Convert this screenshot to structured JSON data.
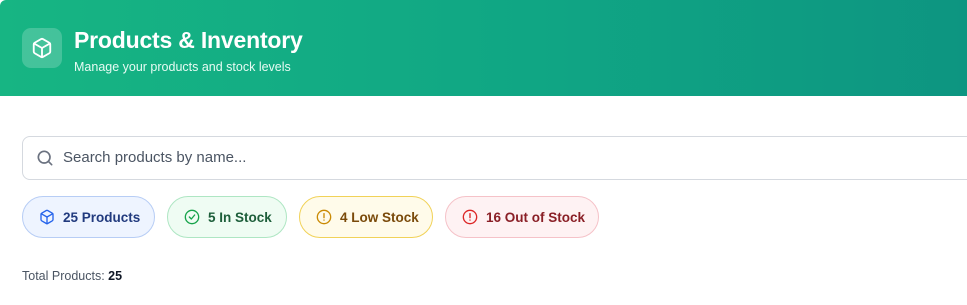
{
  "header": {
    "icon": "package-icon",
    "title": "Products & Inventory",
    "subtitle": "Manage your products and stock levels"
  },
  "search": {
    "icon": "search-icon",
    "placeholder": "Search products by name...",
    "value": ""
  },
  "stats": {
    "products": {
      "label": "25 Products",
      "icon": "package-icon",
      "color": "#2563eb"
    },
    "in_stock": {
      "label": "5 In Stock",
      "icon": "check-circle-icon",
      "color": "#16a34a"
    },
    "low_stock": {
      "label": "4 Low Stock",
      "icon": "alert-circle-icon",
      "color": "#ca8a04"
    },
    "out_of_stock": {
      "label": "16 Out of Stock",
      "icon": "alert-circle-icon",
      "color": "#dc2626"
    }
  },
  "summary": {
    "total_label": "Total Products:",
    "total_value": "25"
  },
  "colors": {
    "header_gradient_start": "#17b583",
    "header_gradient_end": "#0d9581"
  }
}
